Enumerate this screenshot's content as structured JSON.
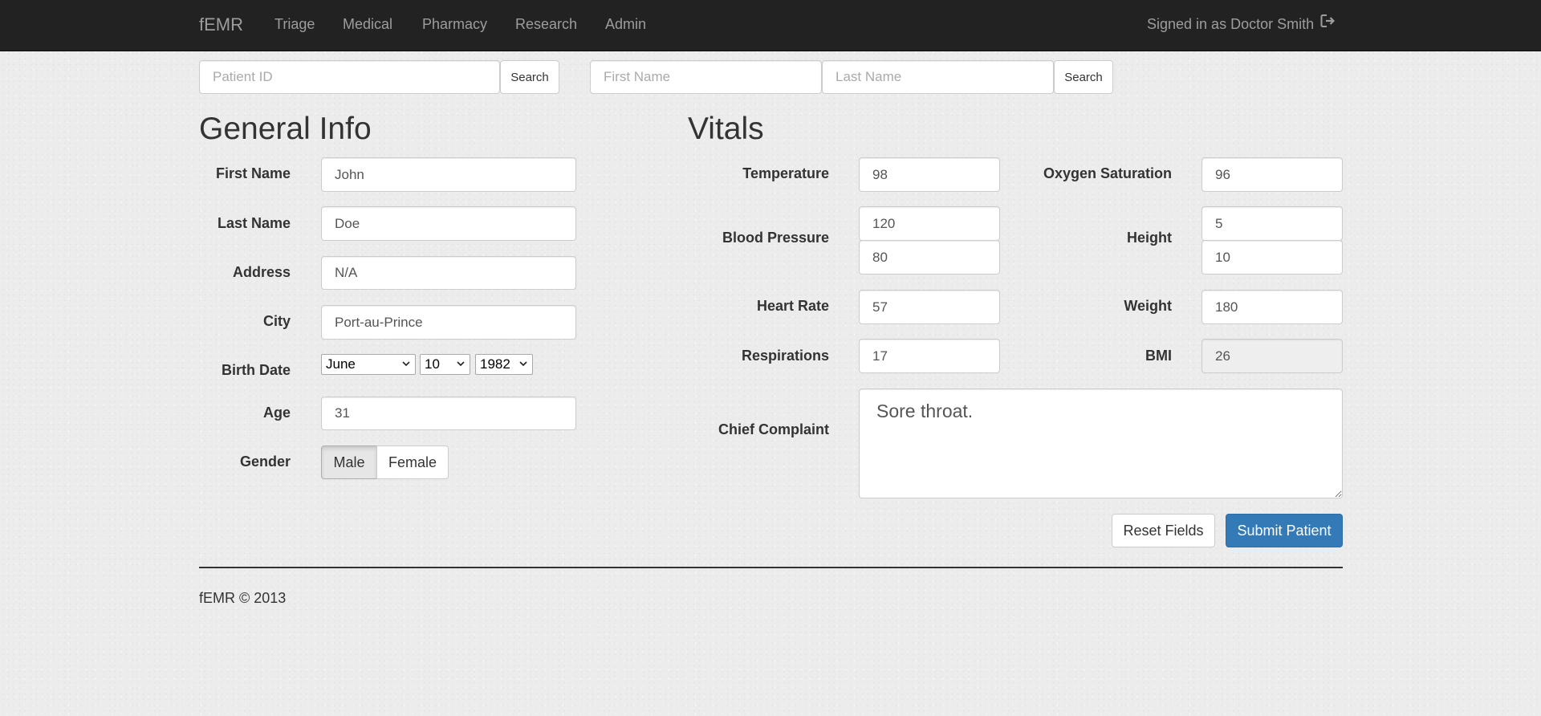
{
  "nav": {
    "brand": "fEMR",
    "links": [
      "Triage",
      "Medical",
      "Pharmacy",
      "Research",
      "Admin"
    ],
    "user": "Signed in as Doctor Smith"
  },
  "search": {
    "patient_id_placeholder": "Patient ID",
    "search_label": "Search",
    "first_name_placeholder": "First Name",
    "last_name_placeholder": "Last Name",
    "search2_label": "Search"
  },
  "general": {
    "heading": "General Info",
    "first_name_label": "First Name",
    "first_name": "John",
    "last_name_label": "Last Name",
    "last_name": "Doe",
    "address_label": "Address",
    "address": "N/A",
    "city_label": "City",
    "city": "Port-au-Prince",
    "birth_date_label": "Birth Date",
    "birth_month": "June",
    "birth_day": "10",
    "birth_year": "1982",
    "age_label": "Age",
    "age": "31",
    "gender_label": "Gender",
    "gender_options": [
      "Male",
      "Female"
    ],
    "gender_selected": "Male"
  },
  "vitals": {
    "heading": "Vitals",
    "temperature_label": "Temperature",
    "temperature": "98",
    "oxygen_label": "Oxygen Saturation",
    "oxygen": "96",
    "bp_label": "Blood Pressure",
    "bp_systolic": "120",
    "bp_diastolic": "80",
    "height_label": "Height",
    "height_ft": "5",
    "height_in": "10",
    "heart_rate_label": "Heart Rate",
    "heart_rate": "57",
    "weight_label": "Weight",
    "weight": "180",
    "respirations_label": "Respirations",
    "respirations": "17",
    "bmi_label": "BMI",
    "bmi": "26",
    "complaint_label": "Chief Complaint",
    "complaint": "Sore throat."
  },
  "actions": {
    "reset": "Reset Fields",
    "submit": "Submit Patient"
  },
  "footer": "fEMR © 2013",
  "colors": {
    "navbar": "#222222",
    "nav_text": "#9d9d9d",
    "primary": "#337ab7",
    "page_bg": "#ececec"
  },
  "icons": {
    "signout": "sign-out-icon",
    "dropdown": "chevron-down-icon",
    "resize": "resize-grip-icon"
  }
}
